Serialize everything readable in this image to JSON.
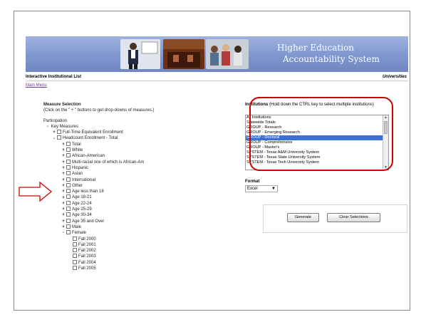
{
  "banner": {
    "title_line1": "Higher Education",
    "title_line2": "Accountability System"
  },
  "titlebar": {
    "title": "Interactive Institutional List",
    "right": "Universities"
  },
  "main_menu": "Main Menu",
  "measure": {
    "heading": "Measure Selection",
    "subheading": "(Click on the \" + \" buttons to get drop-downs of measures.)",
    "category": "Participation",
    "key_measures": "Key Measures",
    "fte": "Full-Time Equivalent Enrollment",
    "headcount": "Headcount Enrollment - Total",
    "items": [
      "Total",
      "White",
      "African-American",
      "Multi-racial one of which is African-Am",
      "Hispanic",
      "Asian",
      "International",
      "Other",
      "Age less than 18",
      "Age 18-21",
      "Age 22-24",
      "Age 25-29",
      "Age 30-34",
      "Age 35 and Over",
      "Male"
    ],
    "female": "Female",
    "female_items": [
      "Fall 2000",
      "Fall 2001",
      "Fall 2002",
      "Fall 2003",
      "Fall 2004",
      "Fall 2005"
    ]
  },
  "institutions": {
    "label": "Institutions",
    "hint": "(Hold down the CTRL key to select multiple institutions)",
    "options": [
      "All Institutions",
      "Statewide Totals",
      "GROUP - Research",
      "GROUP - Emerging Research",
      "GROUP - Doctoral",
      "GROUP - Comprehensive",
      "GROUP - Master's",
      "SYSTEM - Texas A&M University System",
      "SYSTEM - Texas State University System",
      "SYSTEM - Texas Tech University System"
    ],
    "selected": "GROUP - Doctoral"
  },
  "format": {
    "label": "Format",
    "value": "Excel"
  },
  "buttons": {
    "generate": "Generate",
    "clear": "Clear Selections"
  },
  "colors": {
    "banner": "#7f96cf",
    "annotation": "#d00000",
    "selection": "#3a6fd6"
  }
}
